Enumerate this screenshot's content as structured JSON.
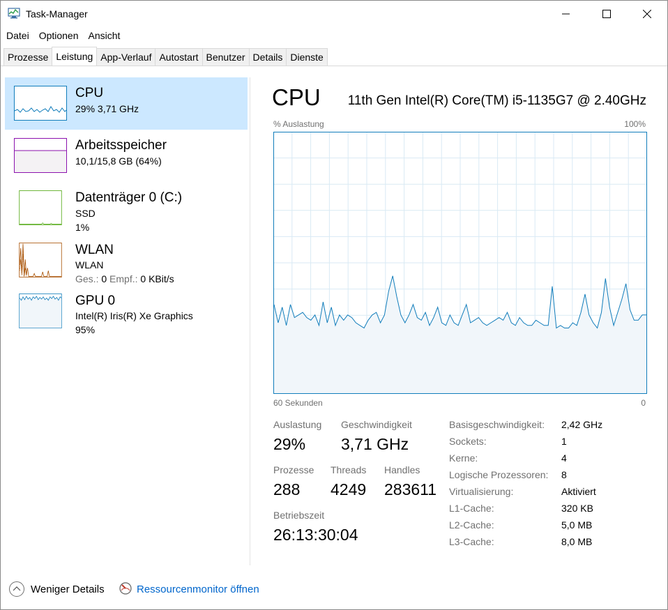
{
  "window": {
    "title": "Task-Manager"
  },
  "menu": [
    "Datei",
    "Optionen",
    "Ansicht"
  ],
  "tabs": [
    "Prozesse",
    "Leistung",
    "App-Verlauf",
    "Autostart",
    "Benutzer",
    "Details",
    "Dienste"
  ],
  "active_tab": "Leistung",
  "sidebar": {
    "items": [
      {
        "title": "CPU",
        "line1": "29%  3,71 GHz",
        "color": "#117dbb"
      },
      {
        "title": "Arbeitsspeicher",
        "line1": "10,1/15,8 GB (64%)",
        "color": "#8b12ae"
      },
      {
        "title": "Datenträger 0 (C:)",
        "line1": "SSD",
        "line2": "1%",
        "color": "#4da60c"
      },
      {
        "title": "WLAN",
        "line1": "WLAN",
        "line2_a": "Ges.:",
        "line2_b": "0",
        "line2_c": "Empf.:",
        "line2_d": "0 KBit/s",
        "color": "#a74f01"
      },
      {
        "title": "GPU 0",
        "line1": "Intel(R) Iris(R) Xe Graphics",
        "line2": "95%",
        "color": "#117dbb"
      }
    ]
  },
  "main": {
    "title": "CPU",
    "model": "11th Gen Intel(R) Core(TM) i5-1135G7 @ 2.40GHz",
    "y_label": "% Auslastung",
    "y_max_label": "100%",
    "x_left_label": "60 Sekunden",
    "x_right_label": "0",
    "stats": {
      "utilization_label": "Auslastung",
      "utilization": "29%",
      "speed_label": "Geschwindigkeit",
      "speed": "3,71 GHz",
      "processes_label": "Prozesse",
      "processes": "288",
      "threads_label": "Threads",
      "threads": "4249",
      "handles_label": "Handles",
      "handles": "283611",
      "uptime_label": "Betriebszeit",
      "uptime": "26:13:30:04"
    },
    "info": [
      {
        "label": "Basisgeschwindigkeit:",
        "value": "2,42 GHz"
      },
      {
        "label": "Sockets:",
        "value": "1"
      },
      {
        "label": "Kerne:",
        "value": "4"
      },
      {
        "label": "Logische Prozessoren:",
        "value": "8"
      },
      {
        "label": "Virtualisierung:",
        "value": "Aktiviert"
      },
      {
        "label": "L1-Cache:",
        "value": "320 KB"
      },
      {
        "label": "L2-Cache:",
        "value": "5,0 MB"
      },
      {
        "label": "L3-Cache:",
        "value": "8,0 MB"
      }
    ]
  },
  "footer": {
    "fewer_details": "Weniger Details",
    "resource_monitor": "Ressourcenmonitor öffnen"
  },
  "colors": {
    "cpu_line": "#117dbb",
    "cpu_fill": "#f1f6fa",
    "selection": "#cce8ff",
    "grid": "#d9eaf4",
    "link": "#0066cc"
  },
  "chart_data": {
    "type": "area",
    "ylim": [
      0,
      100
    ],
    "x_range_seconds": [
      60,
      0
    ],
    "values": [
      34,
      27,
      33,
      26,
      34,
      29,
      30,
      31,
      29,
      28,
      30,
      26,
      35,
      27,
      33,
      26,
      30,
      28,
      30,
      29,
      27,
      26,
      25,
      28,
      30,
      31,
      27,
      30,
      39,
      45,
      37,
      30,
      27,
      30,
      34,
      29,
      28,
      31,
      26,
      29,
      33,
      27,
      26,
      30,
      27,
      26,
      30,
      34,
      27,
      28,
      29,
      27,
      26,
      27,
      28,
      29,
      28,
      31,
      27,
      26,
      29,
      27,
      26,
      26,
      28,
      27,
      26,
      26,
      41,
      25,
      26,
      25,
      25,
      27,
      26,
      31,
      38,
      30,
      27,
      25,
      31,
      44,
      33,
      26,
      31,
      36,
      42,
      32,
      28,
      28,
      30,
      30
    ]
  }
}
